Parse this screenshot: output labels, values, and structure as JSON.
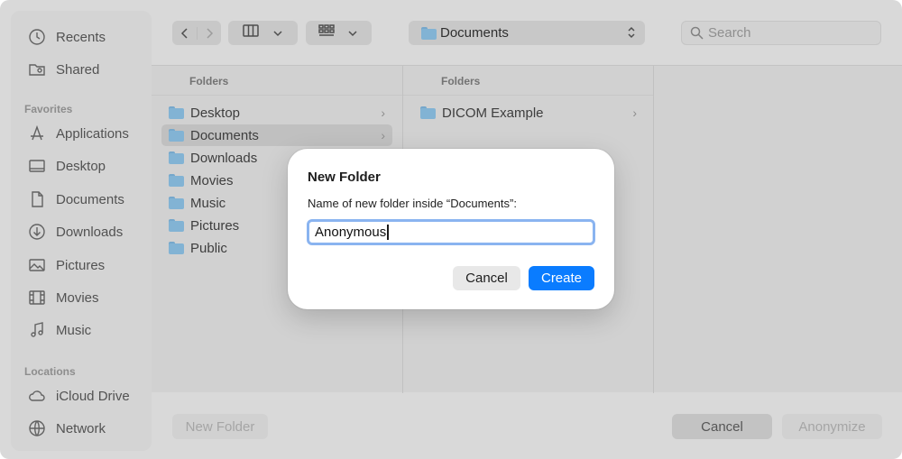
{
  "sidebar": {
    "top_items": [
      {
        "label": "Recents",
        "icon": "clock-icon"
      },
      {
        "label": "Shared",
        "icon": "shared-folder-icon"
      }
    ],
    "favorites_header": "Favorites",
    "favorites": [
      {
        "label": "Applications",
        "icon": "applications-icon"
      },
      {
        "label": "Desktop",
        "icon": "desktop-icon"
      },
      {
        "label": "Documents",
        "icon": "document-icon"
      },
      {
        "label": "Downloads",
        "icon": "download-icon"
      },
      {
        "label": "Pictures",
        "icon": "photo-icon"
      },
      {
        "label": "Movies",
        "icon": "film-icon"
      },
      {
        "label": "Music",
        "icon": "music-note-icon"
      }
    ],
    "locations_header": "Locations",
    "locations": [
      {
        "label": "iCloud Drive",
        "icon": "cloud-icon"
      },
      {
        "label": "Network",
        "icon": "globe-icon"
      }
    ]
  },
  "toolbar": {
    "path": "Documents",
    "search_placeholder": "Search"
  },
  "columns": [
    {
      "header": "Folders",
      "items": [
        "Desktop",
        "Documents",
        "Downloads",
        "Movies",
        "Music",
        "Pictures",
        "Public"
      ],
      "selected": "Documents"
    },
    {
      "header": "Folders",
      "items": [
        "DICOM Example"
      ]
    }
  ],
  "bottom": {
    "new_folder": "New Folder",
    "cancel": "Cancel",
    "anonymize": "Anonymize"
  },
  "dialog": {
    "title": "New Folder",
    "message": "Name of new folder inside “Documents”:",
    "input_value": "Anonymous",
    "cancel": "Cancel",
    "create": "Create"
  },
  "colors": {
    "accent": "#0a7cff",
    "focus_ring": "#8ab4f0",
    "folder": "#8ec3e6"
  }
}
